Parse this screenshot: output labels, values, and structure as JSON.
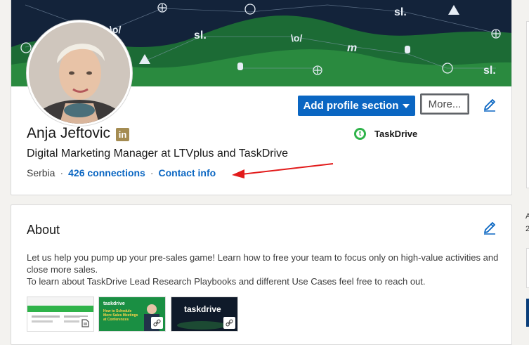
{
  "profile": {
    "name": "Anja Jeftovic",
    "badge_label": "in",
    "headline": "Digital Marketing Manager at LTVplus and TaskDrive",
    "location": "Serbia",
    "separator": "·",
    "connections": "426 connections",
    "contact_info": "Contact info",
    "company": {
      "name": "TaskDrive",
      "logo_letter": "t"
    }
  },
  "actions": {
    "add_profile_section": "Add profile section",
    "more": "More..."
  },
  "banner": {
    "marks": [
      "sl.",
      "\\o/",
      "m",
      "mh",
      "50"
    ]
  },
  "about": {
    "title": "About",
    "paragraph_1": "Let us help you pump up your pre-sales game! Learn how to free your team to focus only on high-value activities and close more sales.",
    "paragraph_2": "To learn about TaskDrive Lead Research Playbooks and different Use Cases feel free to reach out.",
    "media": [
      {
        "type": "document",
        "icon": "document-icon",
        "text": ""
      },
      {
        "type": "link",
        "icon": "link-icon",
        "text": "taskdrive",
        "caption": "How to Schedule More Sales Meetings at Conferences"
      },
      {
        "type": "link",
        "icon": "link-icon",
        "text": "taskdrive"
      }
    ]
  },
  "rail": {
    "chars": [
      "A",
      "2"
    ]
  },
  "colors": {
    "accent": "#0a66c2",
    "banner_dark": "#13233a",
    "banner_green": "#1f7a3a",
    "annotation_arrow": "#e21b1b",
    "linkedin_badge": "#a48c52",
    "taskdrive_green": "#2fb34a"
  }
}
